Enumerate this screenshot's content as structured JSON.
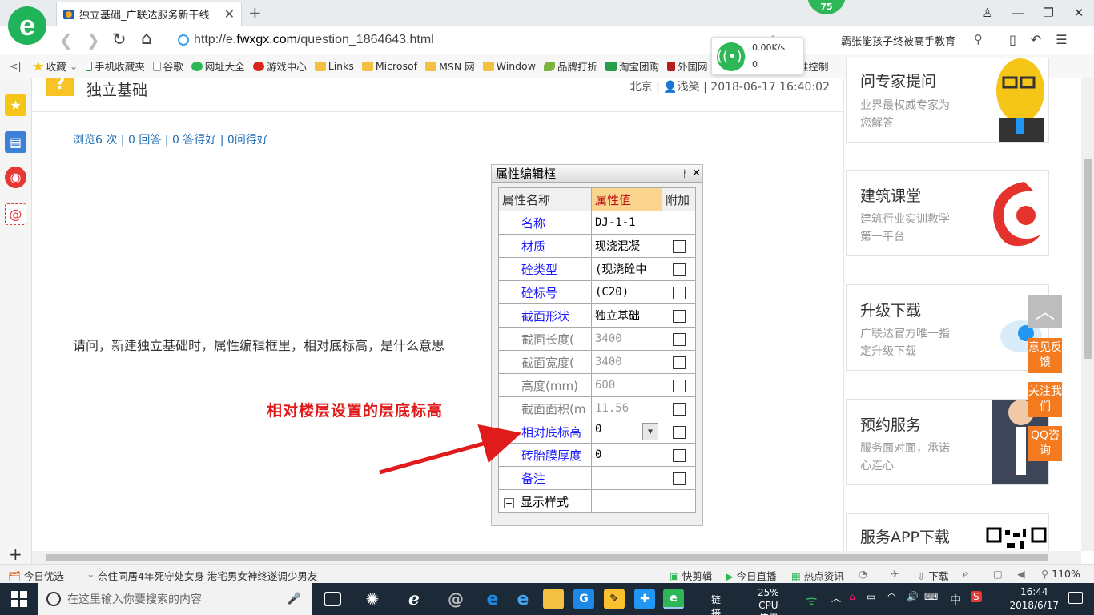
{
  "browser": {
    "logo": "e",
    "tab_title": "独立基础_广联达服务新干线",
    "new_tab": "+",
    "badge": "75",
    "url_prefix": "http://e.",
    "url_domain": "fwxgx.com",
    "url_path": "/question_1864643.html",
    "net_speed": "0.00K/s",
    "net_count": "0",
    "search_hint": "霸张能孩子终被高手教育"
  },
  "bookmarks": [
    {
      "label": "收藏",
      "icon": "star-icon"
    },
    {
      "label": "手机收藏夹",
      "icon": "phone-icon"
    },
    {
      "label": "谷歌",
      "icon": "page-icon"
    },
    {
      "label": "网址大全",
      "icon": "globe-icon"
    },
    {
      "label": "游戏中心",
      "icon": "game-icon"
    },
    {
      "label": "Links",
      "icon": "folder-icon"
    },
    {
      "label": "Microsof",
      "icon": "folder-icon"
    },
    {
      "label": "MSN 网",
      "icon": "folder-icon"
    },
    {
      "label": "Window",
      "icon": "folder-icon"
    },
    {
      "label": "品牌打折",
      "icon": "leaf-icon"
    },
    {
      "label": "淘宝团购",
      "icon": "taobao-icon"
    },
    {
      "label": "外国网",
      "icon": "page-icon"
    },
    {
      "label": "精准控制",
      "icon": "page-icon"
    }
  ],
  "question": {
    "title": "独立基础",
    "location": "北京",
    "user": "浅笑",
    "datetime": "2018-06-17 16:40:02",
    "stats": "浏览6 次 | 0 回答 | 0 答得好 | 0问得好",
    "text": "请问，新建独立基础时，属性编辑框里，相对底标高，是什么意思",
    "annotation": "相对楼层设置的层底标高"
  },
  "property_panel": {
    "title": "属性编辑框",
    "headers": [
      "属性名称",
      "属性值",
      "附加"
    ],
    "rows": [
      {
        "name": "名称",
        "value": "DJ-1-1",
        "disabled": false,
        "check": false
      },
      {
        "name": "材质",
        "value": "现浇混凝",
        "disabled": false,
        "check": true
      },
      {
        "name": "砼类型",
        "value": "(现浇砼中",
        "disabled": false,
        "check": true
      },
      {
        "name": "砼标号",
        "value": "(C20)",
        "disabled": false,
        "check": true
      },
      {
        "name": "截面形状",
        "value": "独立基础",
        "disabled": false,
        "check": true
      },
      {
        "name": "截面长度(",
        "value": "3400",
        "disabled": true,
        "check": true
      },
      {
        "name": "截面宽度(",
        "value": "3400",
        "disabled": true,
        "check": true
      },
      {
        "name": "高度(mm)",
        "value": "600",
        "disabled": true,
        "check": true
      },
      {
        "name": "截面面积(m",
        "value": "11.56",
        "disabled": true,
        "check": true
      },
      {
        "name": "相对底标高",
        "value": "0",
        "disabled": false,
        "check": true,
        "dropdown": true
      },
      {
        "name": "砖胎膜厚度",
        "value": "0",
        "disabled": false,
        "check": true
      },
      {
        "name": "备注",
        "value": "",
        "disabled": false,
        "check": true
      }
    ],
    "expander": "显示样式"
  },
  "right_cards": [
    {
      "title": "问专家提问",
      "desc": "业界最权威专家为您解答"
    },
    {
      "title": "建筑课堂",
      "desc": "建筑行业实训教学第一平台"
    },
    {
      "title": "升级下载",
      "desc": "广联达官方唯一指定升级下载"
    },
    {
      "title": "预约服务",
      "desc": "服务面对面，承诺心连心"
    },
    {
      "title": "服务APP下载",
      "desc": ""
    }
  ],
  "float_buttons": [
    "意见反馈",
    "关注我们",
    "QQ咨询"
  ],
  "statusbar": {
    "today": "今日优选",
    "headline": "奈住同居4年死守处女身 港宅男女神终遂调少男友",
    "quick_cut": "快剪辑",
    "live": "今日直播",
    "news": "热点资讯",
    "download": "下载",
    "zoom": "110%"
  },
  "taskbar": {
    "search_placeholder": "在这里输入你要搜索的内容",
    "link_label": "链接",
    "cpu_pct": "25%",
    "cpu_label": "CPU使用",
    "ime": "中",
    "time": "16:44",
    "date": "2018/6/17"
  },
  "colors": {
    "accent_green": "#2db757",
    "link_blue": "#1f6eb5",
    "annotation_red": "#e01b1b",
    "float_orange": "#f47a20"
  }
}
